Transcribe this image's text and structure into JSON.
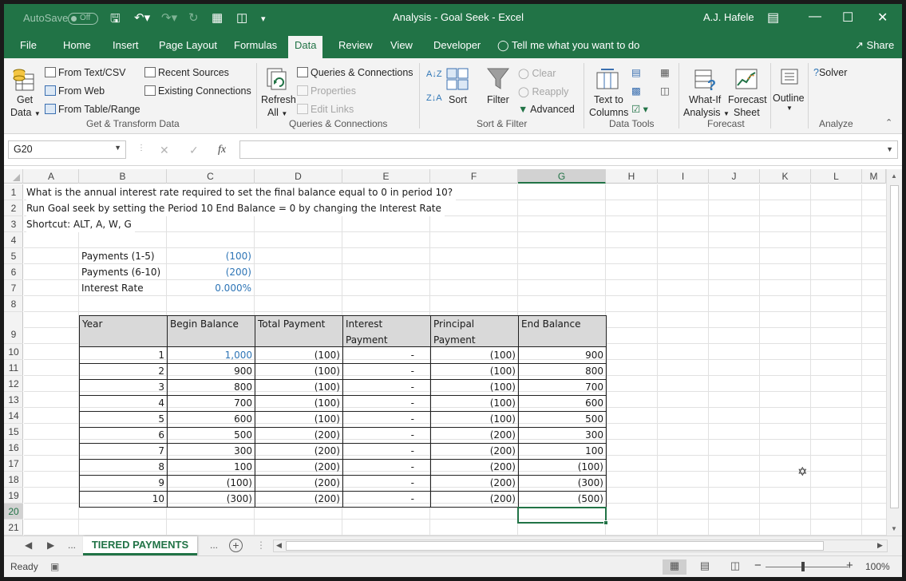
{
  "window": {
    "title": "Analysis - Goal Seek  -  Excel",
    "user": "A.J. Hafele",
    "autosave_label": "AutoSave",
    "autosave_state": "Off"
  },
  "tabs": [
    "File",
    "Home",
    "Insert",
    "Page Layout",
    "Formulas",
    "Data",
    "Review",
    "View",
    "Developer"
  ],
  "active_tab": "Data",
  "tell_me": "Tell me what you want to do",
  "share": "Share",
  "ribbon": {
    "get_data_1": "Get",
    "get_data_2": "Data",
    "from_text": "From Text/CSV",
    "from_web": "From Web",
    "from_table": "From Table/Range",
    "recent_sources": "Recent Sources",
    "existing_connections": "Existing Connections",
    "group_get_transform": "Get & Transform Data",
    "refresh_1": "Refresh",
    "refresh_2": "All",
    "queries_connections": "Queries & Connections",
    "properties": "Properties",
    "edit_links": "Edit Links",
    "group_queries": "Queries & Connections",
    "sort": "Sort",
    "filter": "Filter",
    "clear": "Clear",
    "reapply": "Reapply",
    "advanced": "Advanced",
    "group_sort_filter": "Sort & Filter",
    "text_to_1": "Text to",
    "text_to_2": "Columns",
    "group_data_tools": "Data Tools",
    "whatif_1": "What-If",
    "whatif_2": "Analysis",
    "forecast_1": "Forecast",
    "forecast_2": "Sheet",
    "group_forecast": "Forecast",
    "outline": "Outline",
    "solver": "Solver",
    "group_analyze": "Analyze"
  },
  "name_box": "G20",
  "formula": "",
  "columns": [
    "A",
    "B",
    "C",
    "D",
    "E",
    "F",
    "G",
    "H",
    "I",
    "J",
    "K",
    "L",
    "M"
  ],
  "selected_column": "G",
  "rows": [
    "1",
    "2",
    "3",
    "4",
    "5",
    "6",
    "7",
    "8",
    "9",
    "10",
    "11",
    "12",
    "13",
    "14",
    "15",
    "16",
    "17",
    "18",
    "19",
    "20",
    "21"
  ],
  "selected_row": "20",
  "notes": {
    "line1": "What is the annual interest rate required to set the final balance equal to 0 in period 10?",
    "line2": "Run Goal seek by setting the Period 10 End Balance = 0 by changing the Interest Rate",
    "line3": "Shortcut: ALT, A, W, G"
  },
  "inputs": {
    "pay1_label": "Payments (1-5)",
    "pay1_value": "(100)",
    "pay2_label": "Payments (6-10)",
    "pay2_value": "(200)",
    "rate_label": "Interest Rate",
    "rate_value": "0.000%"
  },
  "table": {
    "headers": [
      "Year",
      "Begin Balance",
      "Total Payment",
      "Interest Payment",
      "Principal Payment",
      "End Balance"
    ],
    "rows": [
      [
        "1",
        "1,000",
        "(100)",
        "-",
        "(100)",
        "900"
      ],
      [
        "2",
        "900",
        "(100)",
        "-",
        "(100)",
        "800"
      ],
      [
        "3",
        "800",
        "(100)",
        "-",
        "(100)",
        "700"
      ],
      [
        "4",
        "700",
        "(100)",
        "-",
        "(100)",
        "600"
      ],
      [
        "5",
        "600",
        "(100)",
        "-",
        "(100)",
        "500"
      ],
      [
        "6",
        "500",
        "(200)",
        "-",
        "(200)",
        "300"
      ],
      [
        "7",
        "300",
        "(200)",
        "-",
        "(200)",
        "100"
      ],
      [
        "8",
        "100",
        "(200)",
        "-",
        "(200)",
        "(100)"
      ],
      [
        "9",
        "(100)",
        "(200)",
        "-",
        "(200)",
        "(300)"
      ],
      [
        "10",
        "(300)",
        "(200)",
        "-",
        "(200)",
        "(500)"
      ]
    ]
  },
  "sheet_tab": "TIERED PAYMENTS",
  "ellipsis": "...",
  "status": "Ready",
  "zoom": "100%",
  "colors": {
    "excel_green": "#217346",
    "input_blue": "#2e75b6"
  }
}
